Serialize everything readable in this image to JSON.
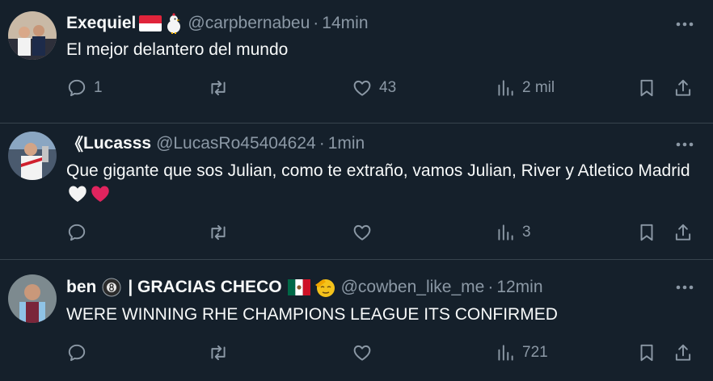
{
  "tweets": [
    {
      "name": "Exequiel",
      "handle": "@carpbernabeu",
      "separator": "·",
      "time": "14min",
      "text": "El mejor delantero del mundo",
      "reply_count": "1",
      "like_count": "43",
      "view_count": "2 mil",
      "name_emojis": [
        "flag-monaco",
        "chicken"
      ]
    },
    {
      "name_prefix": "《",
      "name": "Lucasss",
      "handle": "@LucasRo45404624",
      "separator": "·",
      "time": "1min",
      "text": "Que gigante que sos Julian, como te extraño, vamos Julian, River y Atletico Madrid",
      "text_emojis": [
        "white-heart",
        "red-heart"
      ],
      "reply_count": "",
      "like_count": "",
      "view_count": "3"
    },
    {
      "name": "ben",
      "name_suffix": "| GRACIAS CHECO",
      "handle": "@cowben_like_me",
      "separator": "·",
      "time": "12min",
      "text": "WERE WINNING RHE CHAMPIONS LEAGUE ITS CONFIRMED",
      "reply_count": "",
      "like_count": "",
      "view_count": "721",
      "name_emojis": [
        "8-ball",
        "flag-mexico",
        "saluting-face"
      ]
    }
  ],
  "colors": {
    "background": "#15202b",
    "divider": "#38444d",
    "secondary_text": "#8b98a5",
    "primary_text": "#f7f9f9",
    "heart_red": "#e0245e"
  }
}
